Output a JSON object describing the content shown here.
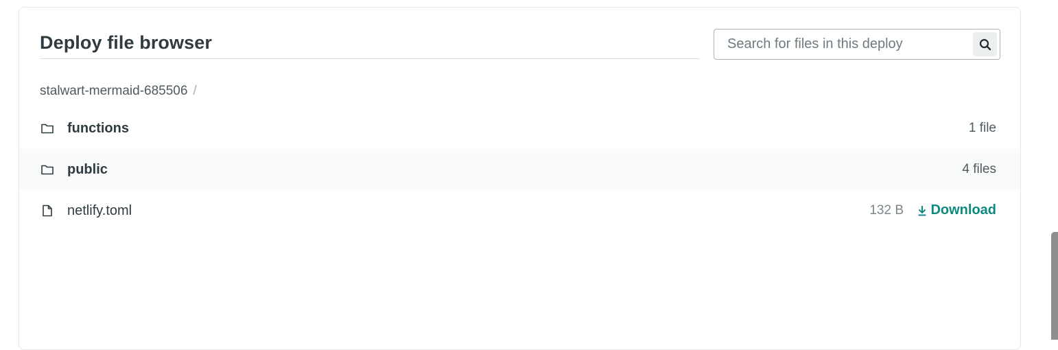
{
  "browser": {
    "title": "Deploy file browser",
    "search": {
      "placeholder": "Search for files in this deploy",
      "value": ""
    }
  },
  "breadcrumb": {
    "root": "stalwart-mermaid-685506",
    "separator": "/"
  },
  "entries": [
    {
      "type": "folder",
      "name": "functions",
      "meta": "1 file",
      "icon": "folder-icon"
    },
    {
      "type": "folder",
      "name": "public",
      "meta": "4 files",
      "icon": "folder-icon"
    },
    {
      "type": "file",
      "name": "netlify.toml",
      "size": "132 B",
      "action": "Download",
      "icon": "file-icon"
    }
  ],
  "colors": {
    "accent": "#0d8a7f",
    "text": "#2d3b41",
    "muted": "#7a868a",
    "row_alt": "#f9fafa"
  }
}
